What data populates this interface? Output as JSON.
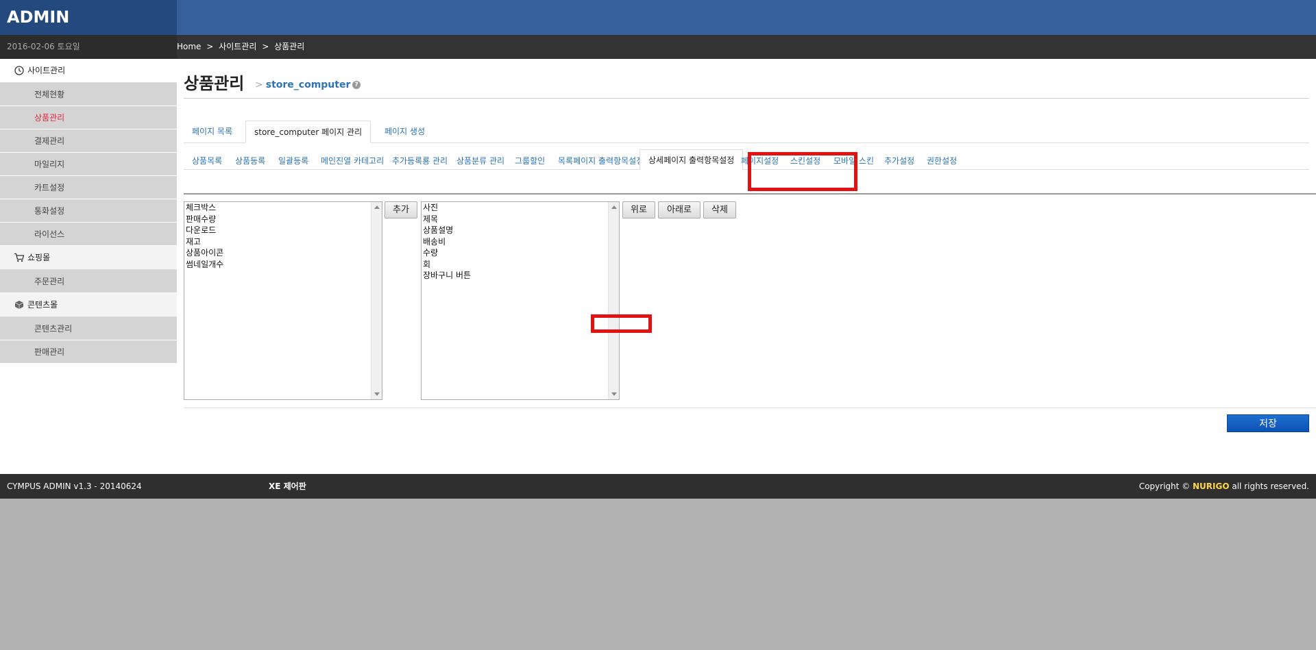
{
  "app": {
    "logo": "ADMIN",
    "date": "2016-02-06 토요일"
  },
  "breadcrumb": [
    "Home",
    ">",
    "사이트관리",
    ">",
    "상품관리"
  ],
  "sidebar": {
    "groups": [
      {
        "label": "사이트관리",
        "icon": "clock-icon",
        "items": [
          "전체현황",
          "상품관리",
          "결제관리",
          "마일리지",
          "카트설정",
          "통화설정",
          "라이선스"
        ],
        "active": "상품관리"
      },
      {
        "label": "쇼핑몰",
        "icon": "cart-icon",
        "items": [
          "주문관리"
        ]
      },
      {
        "label": "콘텐츠몰",
        "icon": "box-icon",
        "items": [
          "콘텐츠관리",
          "판매관리"
        ]
      }
    ]
  },
  "page": {
    "title": "상품관리",
    "separator": ">",
    "subtitle": "store_computer",
    "help": "?"
  },
  "tabs1": [
    "페이지 목록",
    "store_computer 페이지 관리",
    "페이지 생성"
  ],
  "tabs1_active": "store_computer 페이지 관리",
  "tabs2": [
    "상품목록",
    "상품등록",
    "일괄등록",
    "메인진열 카테고리",
    "추가등록룡 관리",
    "상품분류 관리",
    "그룹할인",
    "목록페이지 출력항목설정",
    "상세페이지 출력항목설정",
    "페이지설정",
    "스킨설정",
    "모바일 스킨",
    "추가설정",
    "권한설정"
  ],
  "tabs2_active": "상세페이지 출력항목설정",
  "available_list": [
    "체크박스",
    "판매수량",
    "다운로드",
    "재고",
    "상품아이콘",
    "썸네일개수"
  ],
  "selected_list": [
    "사진",
    "제목",
    "상품설명",
    "배송비",
    "수량",
    "회",
    "장바구니 버튼"
  ],
  "buttons": {
    "add": "추가",
    "up": "위로",
    "down": "아래로",
    "delete": "삭제",
    "save": "저장"
  },
  "footer": {
    "version": "CYMPUS ADMIN v1.3 - 20140624",
    "xe": "XE 제어판",
    "copyright_pre": "Copyright ©",
    "brand": "NURIGO",
    "copyright_post": "all rights reserved."
  },
  "colors": {
    "header": "#36609a",
    "logo_bg": "#24497f",
    "accent": "#2b74b8",
    "active_menu": "#e2263a",
    "highlight": "#e21212",
    "save": "#1264c8"
  }
}
